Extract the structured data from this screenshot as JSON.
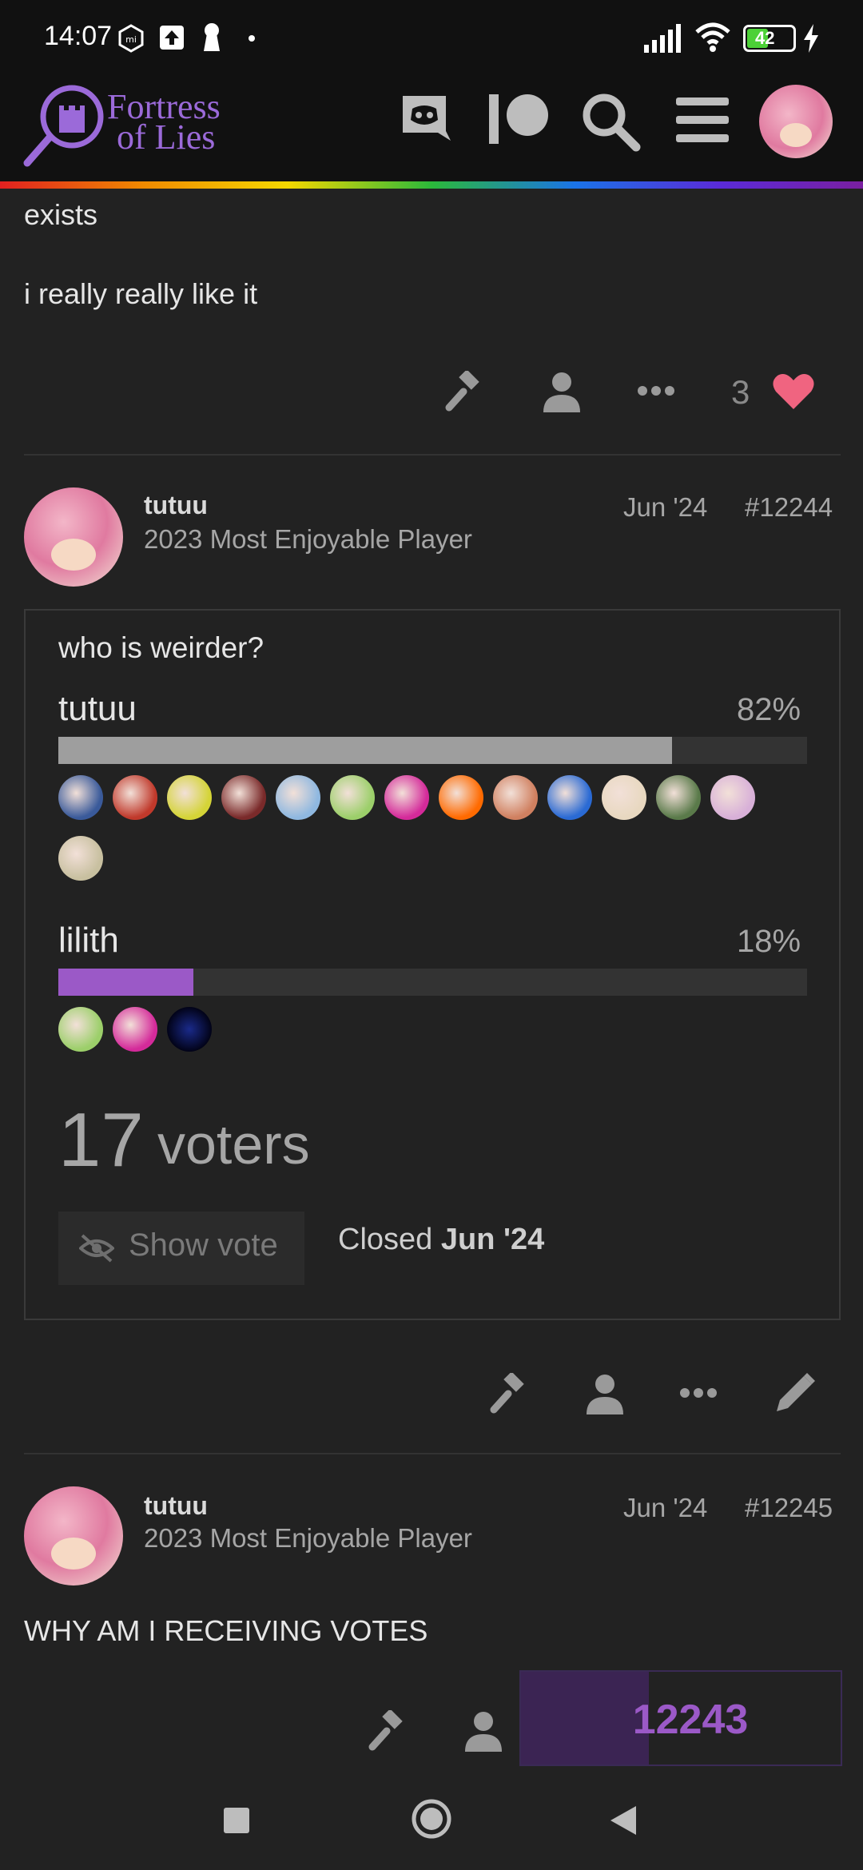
{
  "status_bar": {
    "time": "14:07",
    "battery": "42",
    "icons": [
      "mi-icon",
      "upload-icon",
      "keyhole-icon",
      "dot-icon",
      "signal-icon",
      "wifi-icon",
      "battery-icon",
      "charging-icon"
    ]
  },
  "header": {
    "logo_line1": "Fortress",
    "logo_line2": "of Lies",
    "icons": [
      "discord-icon",
      "patreon-icon",
      "search-icon",
      "menu-icon",
      "user-avatar"
    ]
  },
  "previous_post": {
    "line1": "exists",
    "line2": "i really really like it",
    "like_count": "3"
  },
  "post_12244": {
    "username": "tutuu",
    "user_title": "2023 Most Enjoyable Player",
    "date": "Jun '24",
    "number": "#12244",
    "poll": {
      "question": "who is weirder?",
      "options": [
        {
          "label": "tutuu",
          "percent": "82%",
          "fraction": 0.82,
          "color": "#9e9e9e",
          "voter_count": 14
        },
        {
          "label": "lilith",
          "percent": "18%",
          "fraction": 0.18,
          "color": "#9b59c7",
          "voter_count": 3
        }
      ],
      "voters_number": "17",
      "voters_label": "voters",
      "show_vote_label": "Show vote",
      "closed_prefix": "Closed",
      "closed_date": "Jun '24"
    }
  },
  "post_12245": {
    "username": "tutuu",
    "user_title": "2023 Most Enjoyable Player",
    "date": "Jun '24",
    "number": "#12245",
    "body": "WHY AM I RECEIVING VOTES"
  },
  "timeline": {
    "current_post": "12243",
    "progress": 0.4
  },
  "colors": {
    "accent_purple": "#9b59c7",
    "like_heart": "#f06480",
    "background": "#222222"
  }
}
